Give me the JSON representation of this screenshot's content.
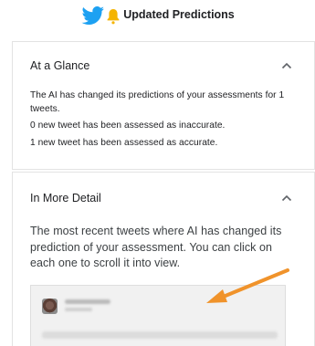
{
  "header": {
    "title": "Updated Predictions",
    "icons": [
      "twitter-bird-icon",
      "bell-icon"
    ]
  },
  "at_a_glance": {
    "title": "At a Glance",
    "lines": [
      "The AI has changed its predictions of your assessments for 1 tweets.",
      "0 new tweet has been assessed as inaccurate.",
      "1 new tweet has been assessed as accurate."
    ]
  },
  "in_more_detail": {
    "title": "In More Detail",
    "description": "The most recent tweets where AI has changed its prediction of your assessment. You can click on each one to scroll it into view."
  },
  "colors": {
    "twitter_blue": "#1da1f2",
    "bell_yellow": "#f4b400",
    "arrow_orange": "#f0932b"
  }
}
